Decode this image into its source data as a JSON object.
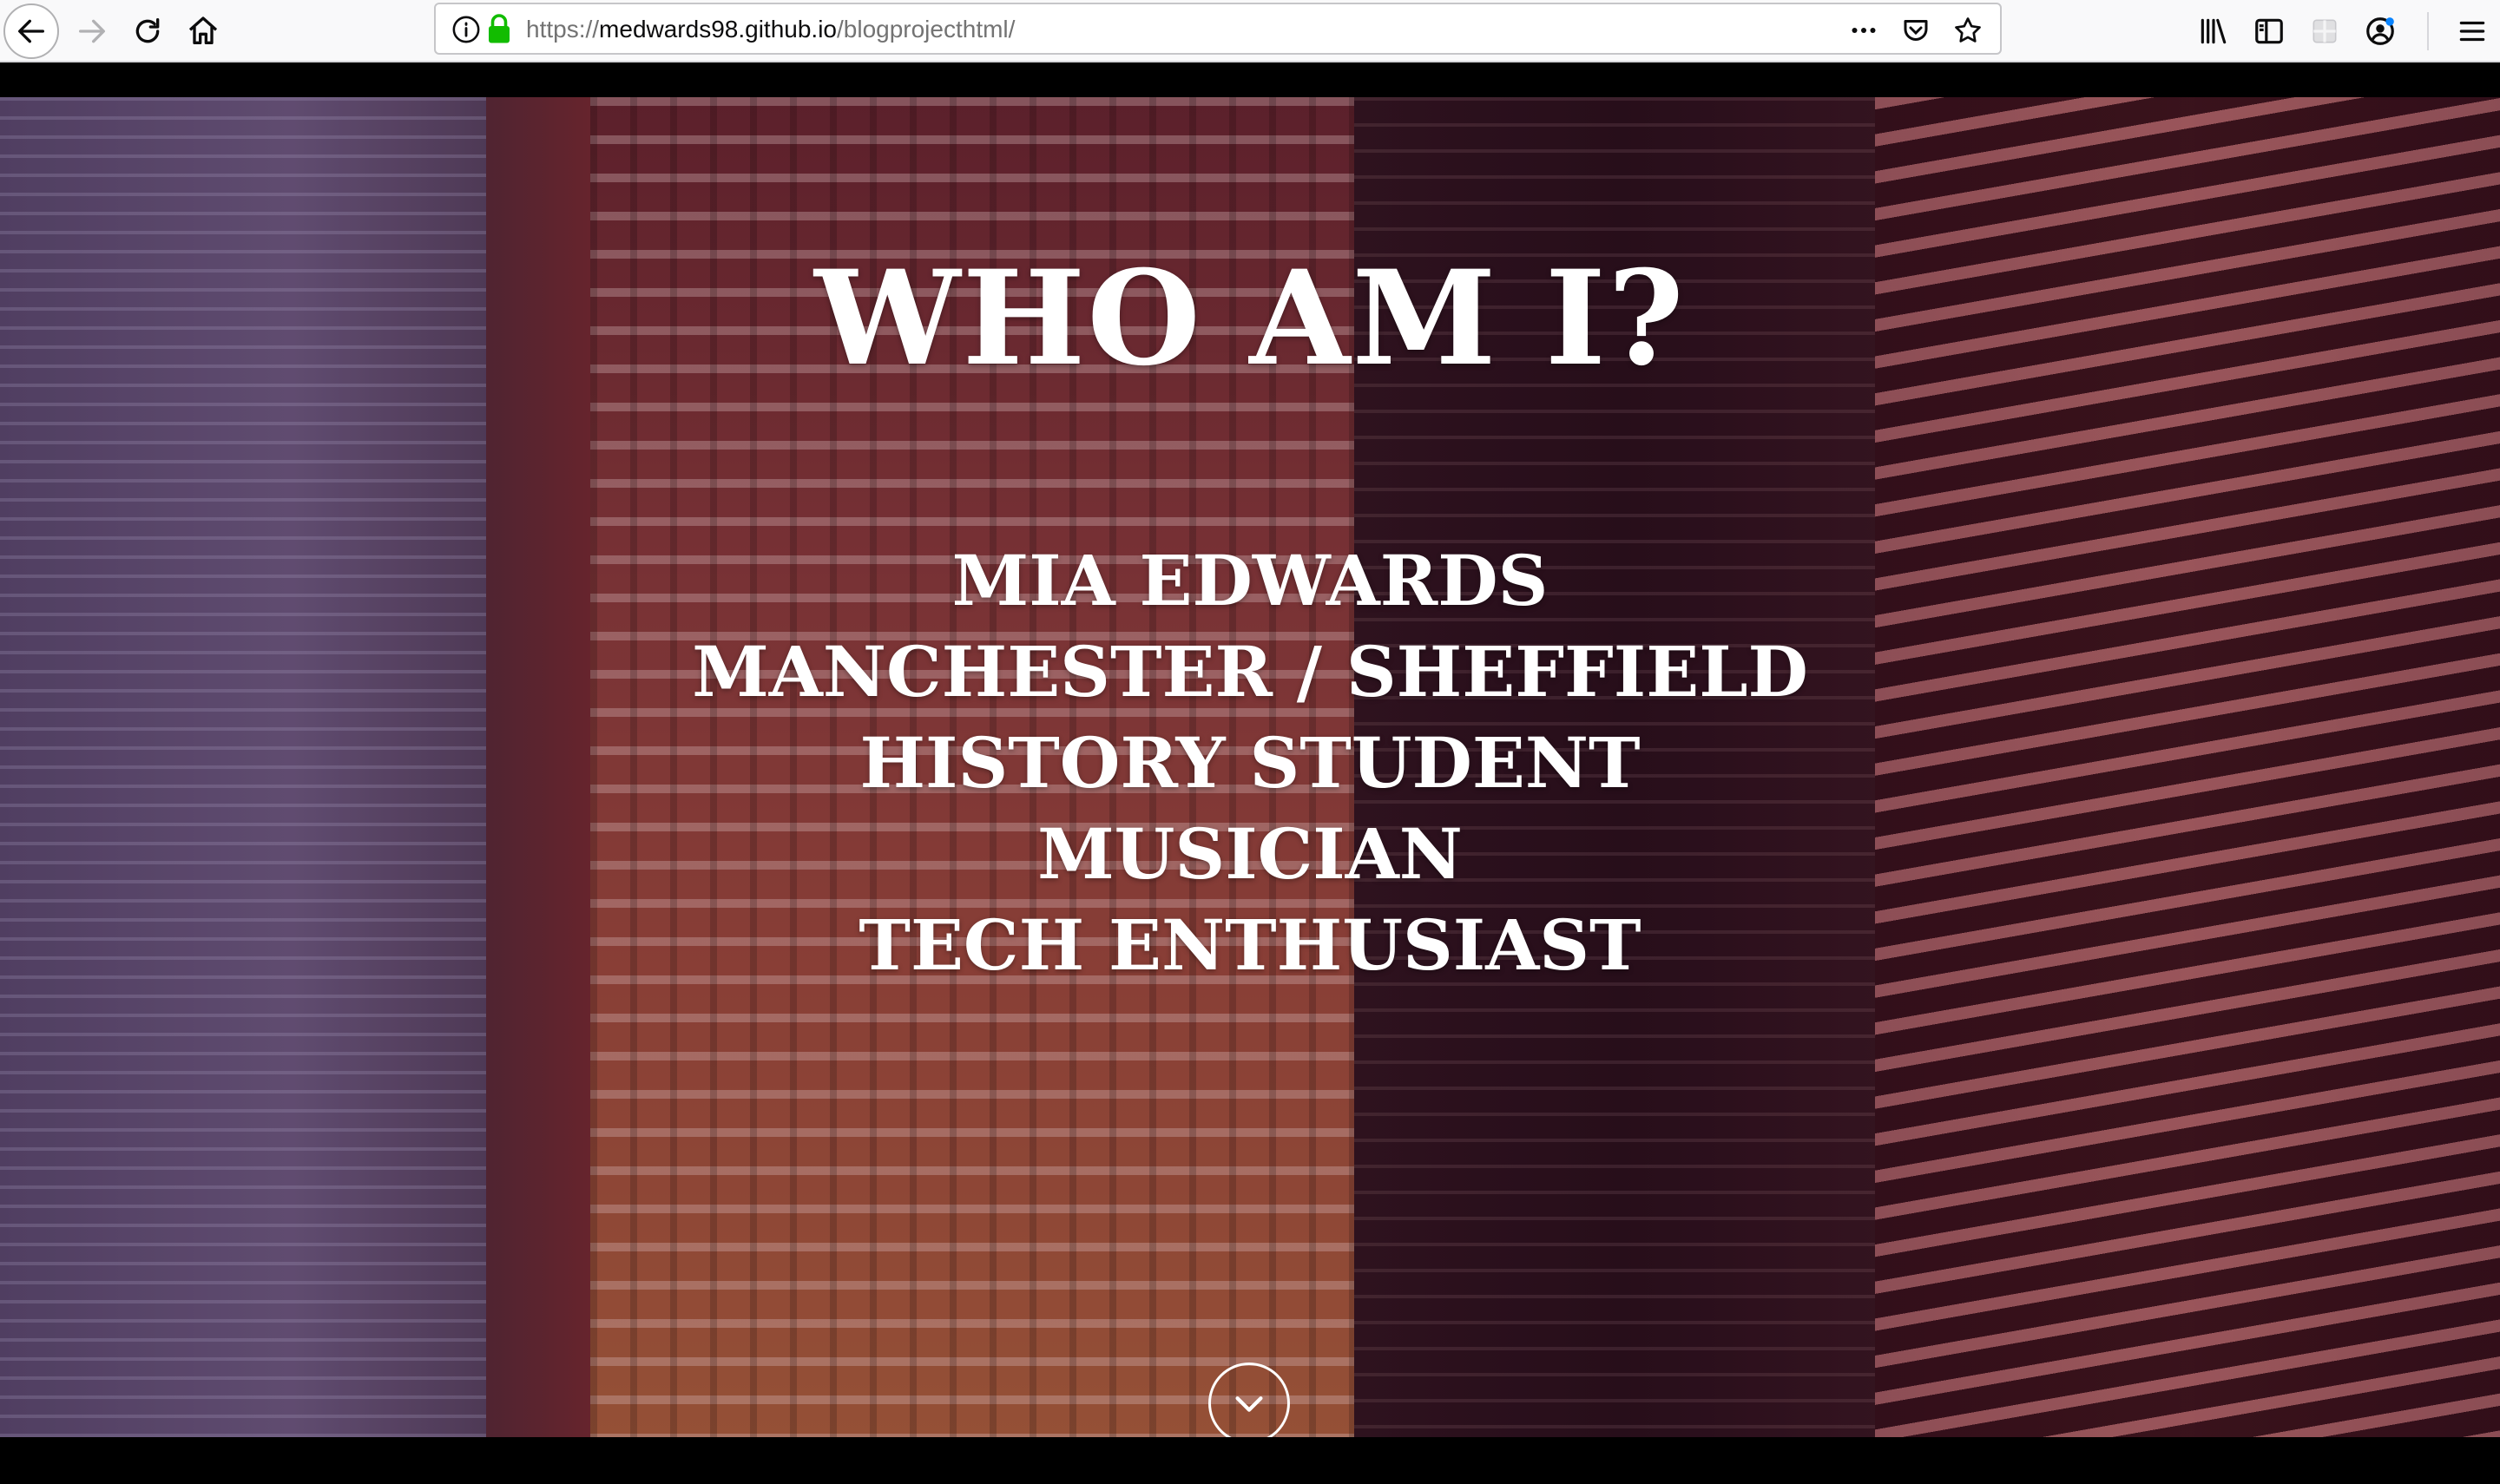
{
  "browser": {
    "url_scheme": "https://",
    "url_domain": "medwards98.github.io",
    "url_path": "/blogprojecthtml/",
    "icons": {
      "back": "back-arrow-icon",
      "forward": "forward-arrow-icon",
      "reload": "reload-icon",
      "home": "home-icon",
      "info": "info-icon",
      "lock": "lock-icon",
      "more": "more-dots-icon",
      "pocket": "pocket-icon",
      "bookmark": "bookmark-star-icon",
      "library": "library-icon",
      "sidebar": "sidebar-icon",
      "extension": "extension-icon",
      "account": "account-icon",
      "menu": "hamburger-menu-icon"
    }
  },
  "hero": {
    "title": "WHO AM I?",
    "lines": [
      "MIA EDWARDS",
      "MANCHESTER / SHEFFIELD",
      "HISTORY STUDENT",
      "MUSICIAN",
      "TECH ENTHUSIAST"
    ],
    "scroll_icon": "chevron-down-icon"
  },
  "colors": {
    "text": "#ffffff",
    "toolbar_bg": "#f9f9fa",
    "lock_green": "#12bc00"
  }
}
